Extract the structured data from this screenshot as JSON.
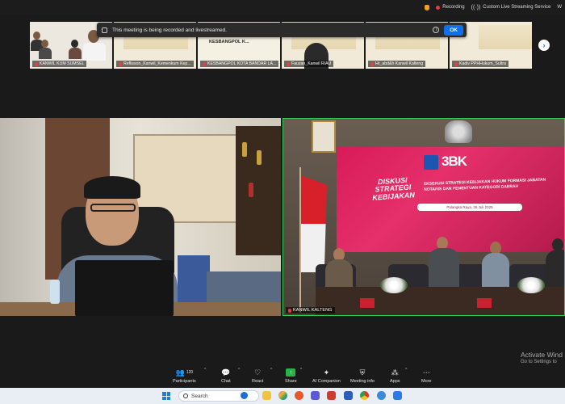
{
  "status_bar": {
    "recording": "Recording",
    "service": "Custom Live Streaming Service",
    "truncated": "W"
  },
  "recording_banner": {
    "message": "This meeting is being recorded and livestreamed.",
    "ok_label": "OK"
  },
  "thumbnails": [
    {
      "label": "KANWIL KUM SUMSEL"
    },
    {
      "label": "Reflisson_Kanwil_Kemenkum Kep..."
    },
    {
      "label": "KESBANGPOL KOTA BANDAR LA...",
      "banner": "KESBANGPOL K..."
    },
    {
      "label": "Fauzan_Kanwil RIAU"
    },
    {
      "label": "Hr_abd&h Kanwil Kalteng"
    },
    {
      "label": "Kadiv PPHHukum_Sultra"
    }
  ],
  "main_videos": {
    "left": {
      "label": ""
    },
    "right": {
      "label": "KANWIL KALTENG",
      "logo": "3BK",
      "screen_title": "DISKUSI STRATEGI KEBIJAKAN",
      "screen_subtitle": "EKSEKUSI STRATEGI KEBIJAKAN HUKUM FORMASI JABATAN NOTARIS DAN PENENTUAN KATEGORI DAERAH",
      "screen_bar": "Palangka Raya, 26 Juli 2025"
    }
  },
  "toolbar": {
    "participants": {
      "label": "Participants",
      "count": "120"
    },
    "chat": {
      "label": "Chat"
    },
    "react": {
      "label": "React"
    },
    "share": {
      "label": "Share"
    },
    "ai_companion": {
      "label": "AI Companion"
    },
    "meeting_info": {
      "label": "Meeting info"
    },
    "apps": {
      "label": "Apps"
    },
    "more": {
      "label": "More"
    }
  },
  "watermark": {
    "line1": "Activate Wind",
    "line2": "Go to Settings to"
  },
  "taskbar": {
    "search_placeholder": "Search"
  },
  "colors": {
    "accent_blue": "#0e71eb",
    "share_green": "#26b34a",
    "active_speaker": "#33cc55",
    "recording_red": "#e04040"
  }
}
